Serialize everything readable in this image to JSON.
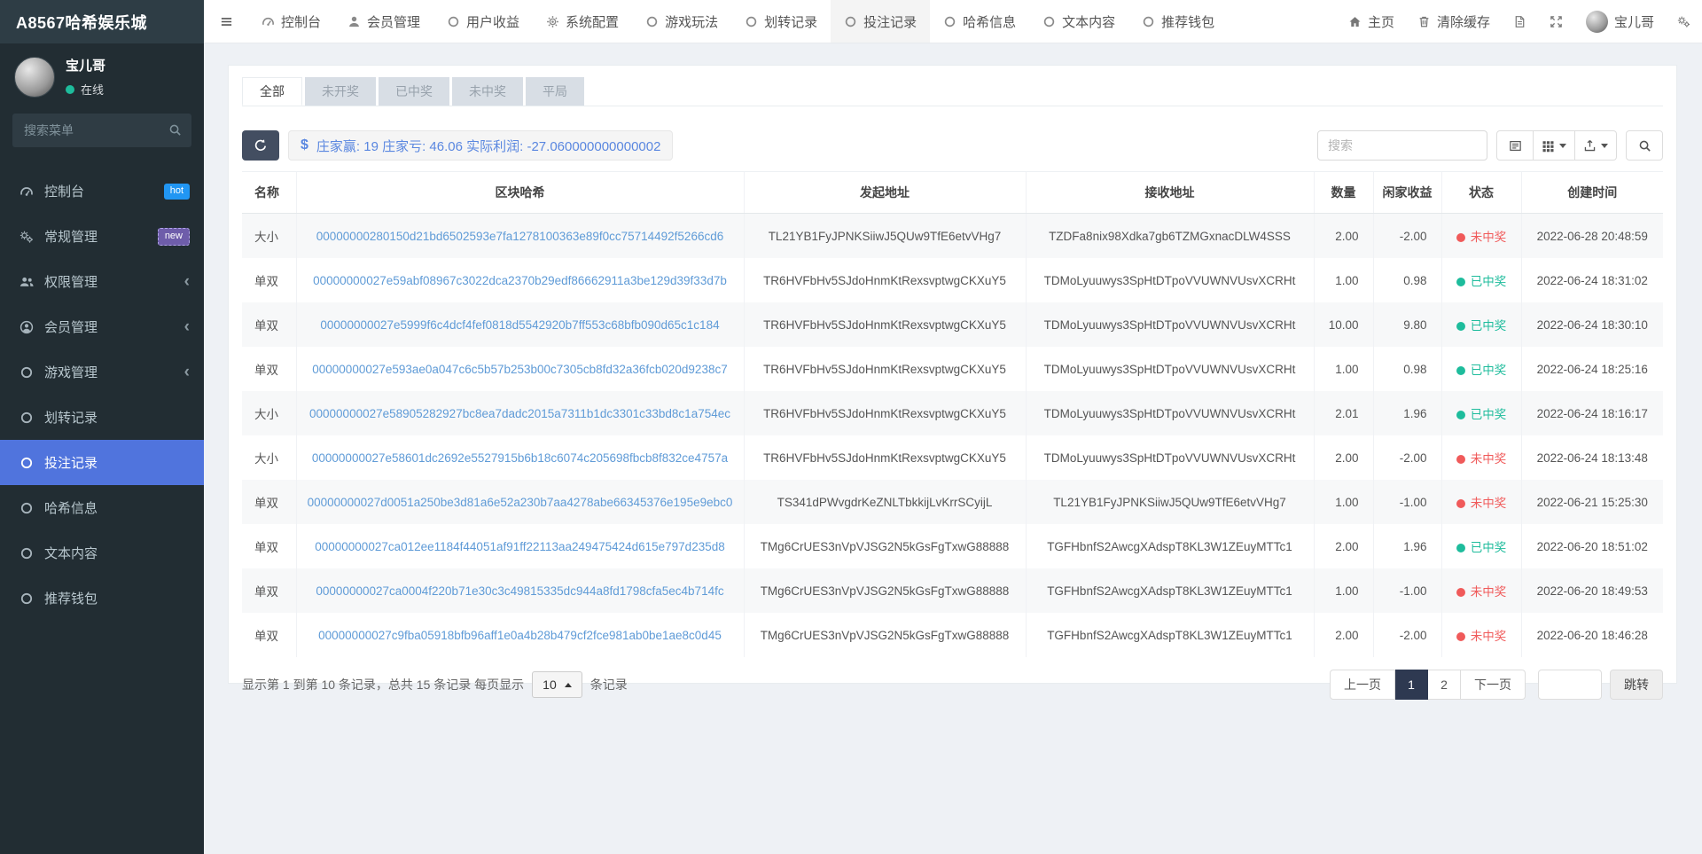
{
  "brand": {
    "title": "A8567哈希娱乐城"
  },
  "colors": {
    "sidebar_active": "#5074dd",
    "badge_hot": "#2196f3",
    "badge_new": "#6e5daa",
    "link_blue": "#5f9bd7",
    "status_win": "#1ebc9c",
    "status_lose": "#f05a5a",
    "pagination_active": "#2e3951",
    "online_green": "#1ebc9c"
  },
  "topnav": {
    "items": [
      {
        "key": "dashboard",
        "label": "控制台",
        "icon": "tachometer",
        "active": false
      },
      {
        "key": "member",
        "label": "会员管理",
        "icon": "user",
        "active": false
      },
      {
        "key": "user-profit",
        "label": "用户收益",
        "icon": "circle",
        "active": false
      },
      {
        "key": "system-config",
        "label": "系统配置",
        "icon": "gear",
        "active": false
      },
      {
        "key": "game-play",
        "label": "游戏玩法",
        "icon": "circle",
        "active": false
      },
      {
        "key": "transfer-log",
        "label": "划转记录",
        "icon": "circle",
        "active": false
      },
      {
        "key": "bet-log",
        "label": "投注记录",
        "icon": "circle",
        "active": true
      },
      {
        "key": "hash-info",
        "label": "哈希信息",
        "icon": "circle",
        "active": false
      },
      {
        "key": "text-content",
        "label": "文本内容",
        "icon": "circle",
        "active": false
      },
      {
        "key": "wallet",
        "label": "推荐钱包",
        "icon": "circle",
        "active": false
      }
    ],
    "right": {
      "home_label": "主页",
      "clear_cache_label": "清除缓存",
      "username": "宝儿哥"
    }
  },
  "sidebar": {
    "user": {
      "name": "宝儿哥",
      "status": "在线"
    },
    "search_placeholder": "搜索菜单",
    "items": [
      {
        "key": "dashboard",
        "label": "控制台",
        "icon": "tachometer",
        "badge": "hot",
        "badge_class": "badge-hot"
      },
      {
        "key": "general",
        "label": "常规管理",
        "icon": "cogs",
        "badge": "new",
        "badge_class": "badge-new"
      },
      {
        "key": "permission",
        "label": "权限管理",
        "icon": "users",
        "chevron": true
      },
      {
        "key": "member",
        "label": "会员管理",
        "icon": "user-circle",
        "chevron": true
      },
      {
        "key": "game",
        "label": "游戏管理",
        "icon": "circle",
        "chevron": true
      },
      {
        "key": "transfer-log",
        "label": "划转记录",
        "icon": "circle"
      },
      {
        "key": "bet-log",
        "label": "投注记录",
        "icon": "circle",
        "active": true
      },
      {
        "key": "hash-info",
        "label": "哈希信息",
        "icon": "circle"
      },
      {
        "key": "text-content",
        "label": "文本内容",
        "icon": "circle"
      },
      {
        "key": "wallet",
        "label": "推荐钱包",
        "icon": "circle"
      }
    ]
  },
  "tabs": {
    "active_index": 0,
    "items": [
      {
        "key": "all",
        "label": "全部"
      },
      {
        "key": "pending",
        "label": "未开奖"
      },
      {
        "key": "win",
        "label": "已中奖"
      },
      {
        "key": "lose",
        "label": "未中奖"
      },
      {
        "key": "draw",
        "label": "平局"
      }
    ]
  },
  "toolbar": {
    "stats_dollar": "$",
    "stats_text": "庄家赢: 19 庄家亏: 46.06 实际利润: -27.060000000000002",
    "search_placeholder": "搜索"
  },
  "table": {
    "columns": [
      "名称",
      "区块哈希",
      "发起地址",
      "接收地址",
      "数量",
      "闲家收益",
      "状态",
      "创建时间"
    ],
    "column_keys": [
      "name",
      "block-hash",
      "from-address",
      "to-address",
      "amount",
      "player-profit",
      "status",
      "created-time"
    ],
    "rows": [
      {
        "name": "大小",
        "hash": "00000000280150d21bd6502593e7fa1278100363e89f0cc75714492f5266cd6",
        "from": "TL21YB1FyJPNKSiiwJ5QUw9TfE6etvVHg7",
        "to": "TZDFa8nix98Xdka7gb6TZMGxnacDLW4SSS",
        "amount": "2.00",
        "profit": "-2.00",
        "status": "未中奖",
        "status_type": "lose",
        "created": "2022-06-28 20:48:59"
      },
      {
        "name": "单双",
        "hash": "00000000027e59abf08967c3022dca2370b29edf86662911a3be129d39f33d7b",
        "from": "TR6HVFbHv5SJdoHnmKtRexsvptwgCKXuY5",
        "to": "TDMoLyuuwys3SpHtDTpoVVUWNVUsvXCRHt",
        "amount": "1.00",
        "profit": "0.98",
        "status": "已中奖",
        "status_type": "win",
        "created": "2022-06-24 18:31:02"
      },
      {
        "name": "单双",
        "hash": "00000000027e5999f6c4dcf4fef0818d5542920b7ff553c68bfb090d65c1c184",
        "from": "TR6HVFbHv5SJdoHnmKtRexsvptwgCKXuY5",
        "to": "TDMoLyuuwys3SpHtDTpoVVUWNVUsvXCRHt",
        "amount": "10.00",
        "profit": "9.80",
        "status": "已中奖",
        "status_type": "win",
        "created": "2022-06-24 18:30:10"
      },
      {
        "name": "单双",
        "hash": "00000000027e593ae0a047c6c5b57b253b00c7305cb8fd32a36fcb020d9238c7",
        "from": "TR6HVFbHv5SJdoHnmKtRexsvptwgCKXuY5",
        "to": "TDMoLyuuwys3SpHtDTpoVVUWNVUsvXCRHt",
        "amount": "1.00",
        "profit": "0.98",
        "status": "已中奖",
        "status_type": "win",
        "created": "2022-06-24 18:25:16"
      },
      {
        "name": "大小",
        "hash": "00000000027e58905282927bc8ea7dadc2015a7311b1dc3301c33bd8c1a754ec",
        "from": "TR6HVFbHv5SJdoHnmKtRexsvptwgCKXuY5",
        "to": "TDMoLyuuwys3SpHtDTpoVVUWNVUsvXCRHt",
        "amount": "2.01",
        "profit": "1.96",
        "status": "已中奖",
        "status_type": "win",
        "created": "2022-06-24 18:16:17"
      },
      {
        "name": "大小",
        "hash": "00000000027e58601dc2692e5527915b6b18c6074c205698fbcb8f832ce4757a",
        "from": "TR6HVFbHv5SJdoHnmKtRexsvptwgCKXuY5",
        "to": "TDMoLyuuwys3SpHtDTpoVVUWNVUsvXCRHt",
        "amount": "2.00",
        "profit": "-2.00",
        "status": "未中奖",
        "status_type": "lose",
        "created": "2022-06-24 18:13:48"
      },
      {
        "name": "单双",
        "hash": "00000000027d0051a250be3d81a6e52a230b7aa4278abe66345376e195e9ebc0",
        "from": "TS341dPWvgdrKeZNLTbkkijLvKrrSCyijL",
        "to": "TL21YB1FyJPNKSiiwJ5QUw9TfE6etvVHg7",
        "amount": "1.00",
        "profit": "-1.00",
        "status": "未中奖",
        "status_type": "lose",
        "created": "2022-06-21 15:25:30"
      },
      {
        "name": "单双",
        "hash": "00000000027ca012ee1184f44051af91ff22113aa249475424d615e797d235d8",
        "from": "TMg6CrUES3nVpVJSG2N5kGsFgTxwG88888",
        "to": "TGFHbnfS2AwcgXAdspT8KL3W1ZEuyMTTc1",
        "amount": "2.00",
        "profit": "1.96",
        "status": "已中奖",
        "status_type": "win",
        "created": "2022-06-20 18:51:02"
      },
      {
        "name": "单双",
        "hash": "00000000027ca0004f220b71e30c3c49815335dc944a8fd1798cfa5ec4b714fc",
        "from": "TMg6CrUES3nVpVJSG2N5kGsFgTxwG88888",
        "to": "TGFHbnfS2AwcgXAdspT8KL3W1ZEuyMTTc1",
        "amount": "1.00",
        "profit": "-1.00",
        "status": "未中奖",
        "status_type": "lose",
        "created": "2022-06-20 18:49:53"
      },
      {
        "name": "单双",
        "hash": "00000000027c9fba05918bfb96aff1e0a4b28b479cf2fce981ab0be1ae8c0d45",
        "from": "TMg6CrUES3nVpVJSG2N5kGsFgTxwG88888",
        "to": "TGFHbnfS2AwcgXAdspT8KL3W1ZEuyMTTc1",
        "amount": "2.00",
        "profit": "-2.00",
        "status": "未中奖",
        "status_type": "lose",
        "created": "2022-06-20 18:46:28"
      }
    ]
  },
  "pagination": {
    "info_prefix": "显示第 1 到第 10 条记录，总共 15 条记录 每页显示",
    "page_size": "10",
    "info_suffix": "条记录",
    "prev_label": "上一页",
    "pages": [
      "1",
      "2"
    ],
    "active_page": "1",
    "next_label": "下一页",
    "jump_label": "跳转",
    "jump_value": ""
  }
}
